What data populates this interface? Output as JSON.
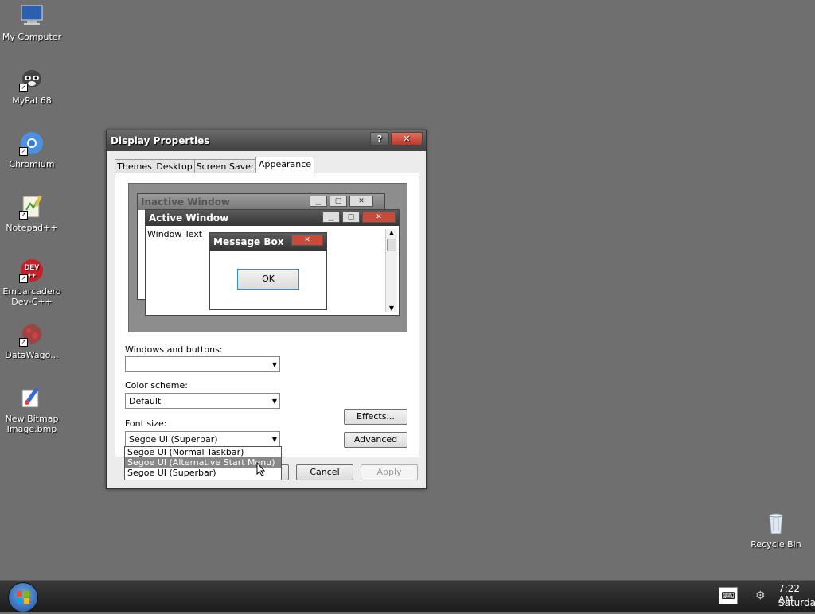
{
  "desktop": {
    "icons": [
      {
        "label": "My Computer"
      },
      {
        "label": "MyPal 68"
      },
      {
        "label": "Chromium"
      },
      {
        "label": "Notepad++"
      },
      {
        "label": "Embarcadero Dev-C++"
      },
      {
        "label": "DataWago..."
      },
      {
        "label": "New Bitmap Image.bmp"
      },
      {
        "label": "Recycle Bin"
      }
    ]
  },
  "dialog": {
    "title": "Display Properties",
    "help_label": "?",
    "close_label": "✕",
    "tabs": [
      "Themes",
      "Desktop",
      "Screen Saver",
      "Appearance"
    ],
    "preview": {
      "inactive_title": "Inactive Window",
      "active_title": "Active Window",
      "window_text": "Window Text",
      "message_title": "Message Box",
      "ok_label": "OK"
    },
    "windows_buttons_label": "Windows and buttons:",
    "windows_buttons_value": "",
    "color_scheme_label": "Color scheme:",
    "color_scheme_value": "Default",
    "font_size_label": "Font size:",
    "font_size_value": "Segoe UI (Superbar)",
    "font_options": [
      "Segoe UI (Normal Taskbar)",
      "Segoe UI (Alternative Start Menu)",
      "Segoe UI (Superbar)"
    ],
    "effects_label": "Effects...",
    "advanced_label": "Advanced",
    "cancel_label": "Cancel",
    "apply_label": "Apply"
  },
  "taskbar": {
    "time": "7:22 AM",
    "day": "Saturday"
  },
  "colors": {
    "desktop": "#6f6f6f",
    "close_red": "#c84a3a",
    "selection": "#888888"
  }
}
